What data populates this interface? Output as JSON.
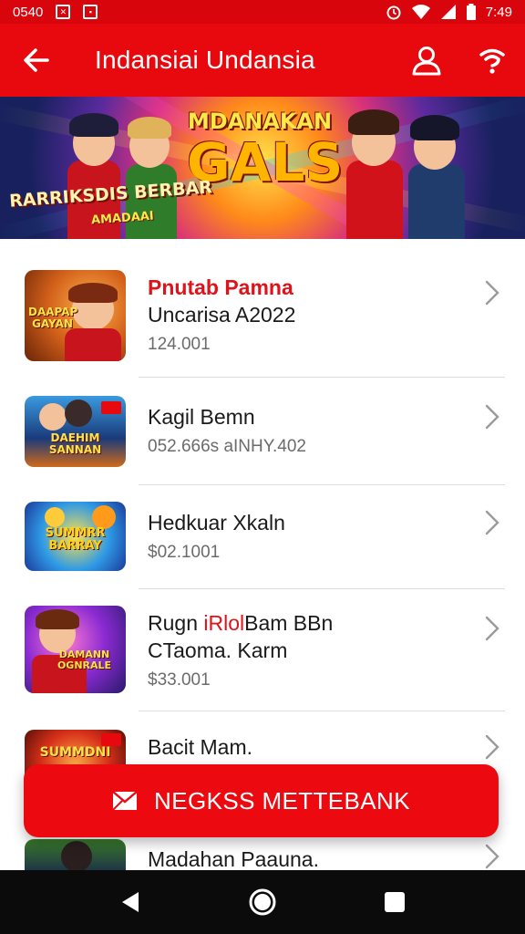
{
  "status_bar": {
    "left_text": "0540",
    "icon_1": "close-box-icon",
    "icon_2": "image-box-icon",
    "right_icons": [
      "alarm-icon",
      "wifi-icon",
      "signal-icon",
      "battery-icon"
    ],
    "time": "7:49"
  },
  "app_bar": {
    "title": "Indansiai Undansia",
    "back_icon": "arrow-left-icon",
    "account_icon": "person-icon",
    "help_icon": "question-icon"
  },
  "banner": {
    "title_top": "MDANAKAN",
    "title_main": "GALS",
    "caption_line1": "RARRIKSDIS BERBAR",
    "caption_line2": "AMADAAI"
  },
  "items": [
    {
      "title": "Pnutab Pamna",
      "title_style": "red",
      "subtitle": "Uncarisa A2022",
      "meta": "124.001",
      "thumb_label": "DAAPAP GAYAN"
    },
    {
      "title": "Kagil Bemn",
      "subtitle": "",
      "meta": "052.666s aINHY.402",
      "thumb_label": "DAEHIM SANNAN"
    },
    {
      "title": "Hedkuar Xkaln",
      "subtitle": "",
      "meta": "$02.1001",
      "thumb_label": "SUMMRR BARRAY"
    },
    {
      "title_part1": "Rugn ",
      "title_highlight": "iRlol",
      "title_part2": "Bam BBn",
      "subtitle": "CTaoma. Karm",
      "meta": "$33.001",
      "thumb_label": "DAMANN OGNRALE"
    },
    {
      "title": "Bacit Mam.",
      "subtitle": "",
      "meta": "",
      "thumb_label": "SUMMDNI"
    },
    {
      "title": "Madahan Paauna.",
      "subtitle": "",
      "meta": "",
      "thumb_label": ""
    }
  ],
  "cta": {
    "label": "NEGKSS METTEBANK",
    "icon": "envelope-icon"
  },
  "nav_bar": {
    "back_icon": "triangle-back-icon",
    "home_icon": "circle-home-icon",
    "recents_icon": "square-recents-icon"
  }
}
